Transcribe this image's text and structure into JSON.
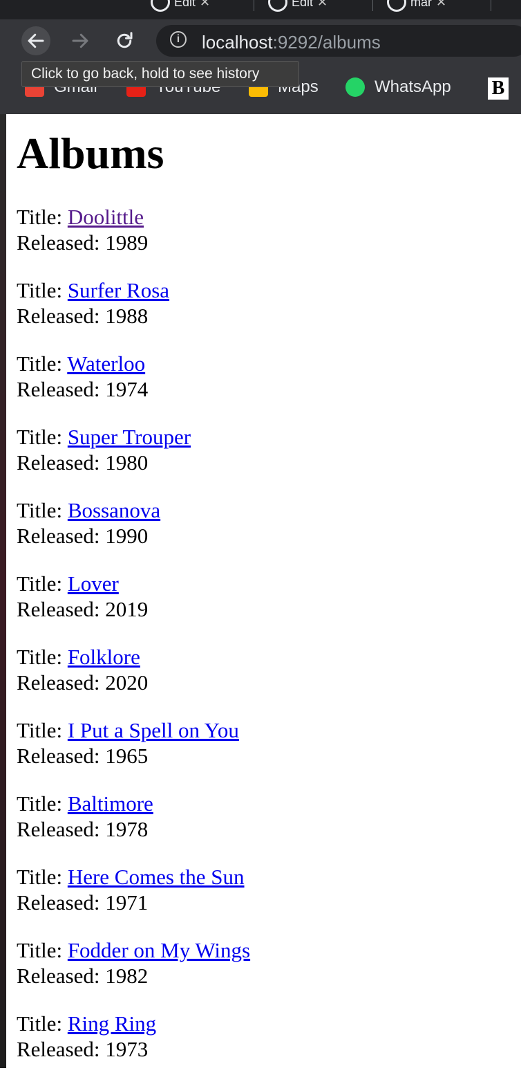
{
  "browser": {
    "tabs": [
      {
        "label": "Edit"
      },
      {
        "label": "Edit"
      },
      {
        "label": "mar"
      }
    ],
    "url_host": "localhost",
    "url_path": ":9292/albums",
    "tooltip": "Click to go back, hold to see history",
    "bookmarks": [
      {
        "label": "Gmail",
        "color": "#ea4335"
      },
      {
        "label": "YouTube",
        "color": "#ff0000"
      },
      {
        "label": "Maps",
        "color": "#34a853"
      },
      {
        "label": "WhatsApp",
        "color": "#25d366"
      },
      {
        "label": "B",
        "color": "#ffffff"
      }
    ]
  },
  "page": {
    "heading": "Albums",
    "title_prefix": "Title:",
    "released_prefix": "Released:",
    "albums": [
      {
        "title": "Doolittle",
        "released": "1989",
        "visited": true
      },
      {
        "title": "Surfer Rosa",
        "released": "1988"
      },
      {
        "title": "Waterloo",
        "released": "1974"
      },
      {
        "title": "Super Trouper",
        "released": "1980"
      },
      {
        "title": "Bossanova",
        "released": "1990"
      },
      {
        "title": "Lover",
        "released": "2019"
      },
      {
        "title": "Folklore",
        "released": "2020"
      },
      {
        "title": "I Put a Spell on You",
        "released": "1965"
      },
      {
        "title": "Baltimore",
        "released": "1978"
      },
      {
        "title": "Here Comes the Sun",
        "released": "1971"
      },
      {
        "title": "Fodder on My Wings",
        "released": "1982"
      },
      {
        "title": "Ring Ring",
        "released": "1973"
      }
    ]
  },
  "colors": {
    "link": "#0000ee",
    "visited_link": "#551a8b",
    "chrome_dark": "#202124",
    "chrome_toolbar": "#35363a"
  }
}
